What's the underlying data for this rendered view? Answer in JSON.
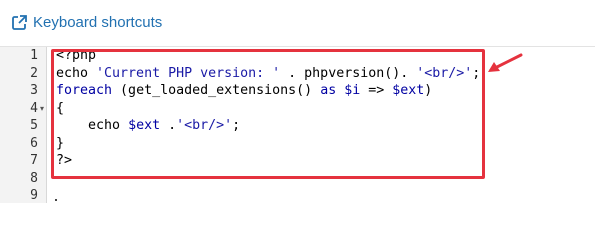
{
  "toolbar": {
    "shortcuts_label": "Keyboard shortcuts",
    "shortcuts_icon": "external-link-icon",
    "link_color": "#2271b1"
  },
  "editor": {
    "line_numbers": [
      "1",
      "2",
      "3",
      "4",
      "5",
      "6",
      "7",
      "8",
      "9"
    ],
    "folded_line": "4",
    "lines": [
      [
        {
          "t": "plain",
          "v": "<?php"
        }
      ],
      [
        {
          "t": "plain",
          "v": "echo "
        },
        {
          "t": "str",
          "v": "'Current PHP version: '"
        },
        {
          "t": "plain",
          "v": " . phpversion(). "
        },
        {
          "t": "str",
          "v": "'<br/>'"
        },
        {
          "t": "plain",
          "v": ";"
        }
      ],
      [
        {
          "t": "kw",
          "v": "foreach"
        },
        {
          "t": "plain",
          "v": " (get_loaded_extensions() "
        },
        {
          "t": "kw",
          "v": "as"
        },
        {
          "t": "plain",
          "v": " "
        },
        {
          "t": "var",
          "v": "$i"
        },
        {
          "t": "plain",
          "v": " => "
        },
        {
          "t": "var",
          "v": "$ext"
        },
        {
          "t": "plain",
          "v": ")"
        }
      ],
      [
        {
          "t": "plain",
          "v": "{"
        }
      ],
      [
        {
          "t": "plain",
          "v": "    echo "
        },
        {
          "t": "var",
          "v": "$ext"
        },
        {
          "t": "plain",
          "v": " ."
        },
        {
          "t": "str",
          "v": "'<br/>'"
        },
        {
          "t": "plain",
          "v": ";"
        }
      ],
      [
        {
          "t": "plain",
          "v": "}"
        }
      ],
      [
        {
          "t": "plain",
          "v": "?>"
        }
      ],
      [],
      []
    ]
  },
  "annotation": {
    "highlight_color": "#e5323e",
    "arrow_icon": "red-arrow-icon"
  }
}
